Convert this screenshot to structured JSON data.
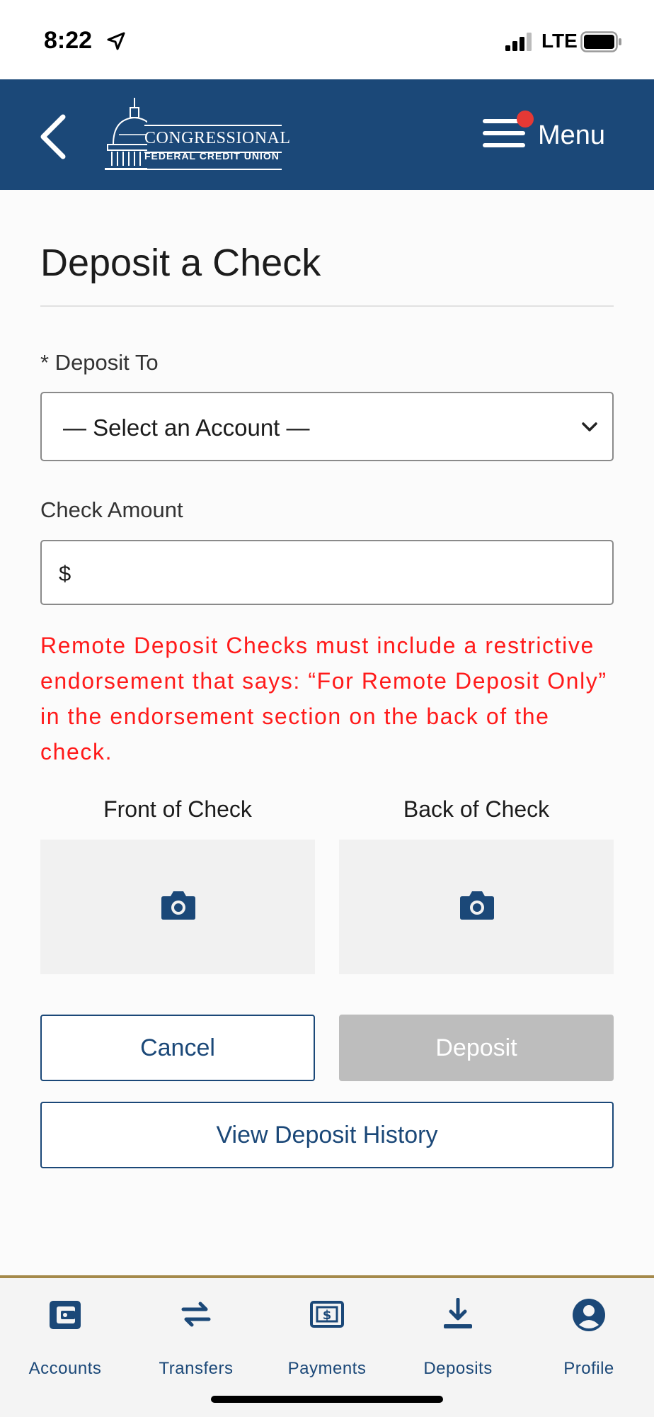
{
  "status_bar": {
    "time": "8:22",
    "network": "LTE"
  },
  "header": {
    "logo_line1": "CONGRESSIONAL",
    "logo_line2": "FEDERAL CREDIT UNION",
    "menu_label": "Menu"
  },
  "page": {
    "title": "Deposit a Check"
  },
  "form": {
    "deposit_to_label": "* Deposit To",
    "deposit_to_value": "— Select an Account —",
    "amount_label": "Check Amount",
    "amount_prefix": "$",
    "amount_value": "",
    "warning": "Remote Deposit Checks must include a restrictive endorsement that says: “For Remote Deposit Only” in the endorsement section on the back of the check.",
    "front_label": "Front of Check",
    "back_label": "Back of Check"
  },
  "buttons": {
    "cancel": "Cancel",
    "deposit": "Deposit",
    "history": "View Deposit History"
  },
  "tabs": [
    {
      "label": "Accounts",
      "icon": "wallet-icon"
    },
    {
      "label": "Transfers",
      "icon": "transfer-arrows-icon"
    },
    {
      "label": "Payments",
      "icon": "dollar-bill-icon"
    },
    {
      "label": "Deposits",
      "icon": "download-icon"
    },
    {
      "label": "Profile",
      "icon": "user-circle-icon"
    }
  ],
  "colors": {
    "brand_navy": "#1b4878",
    "warning_red": "#ff1a1a",
    "notification_dot": "#e53935",
    "tab_bar_accent": "#a4894a",
    "disabled_button": "#bdbdbd"
  }
}
